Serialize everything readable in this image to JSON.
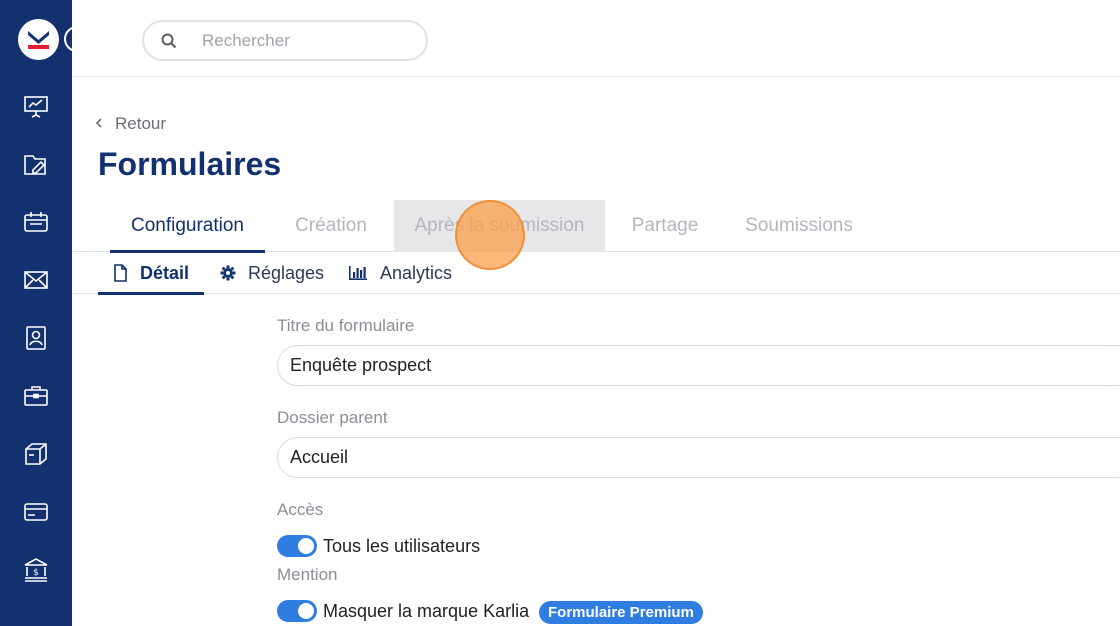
{
  "search": {
    "placeholder": "Rechercher"
  },
  "nav_icons": [
    "presentation-icon",
    "folder-edit-icon",
    "calendar-icon",
    "mail-icon",
    "contact-card-icon",
    "briefcase-icon",
    "box-icon",
    "credit-card-icon",
    "bank-icon"
  ],
  "back": {
    "label": "Retour"
  },
  "page": {
    "title": "Formulaires"
  },
  "tabs": [
    {
      "label": "Configuration",
      "state": "active"
    },
    {
      "label": "Création",
      "state": "inactive"
    },
    {
      "label": "Après la soumission",
      "state": "hover"
    },
    {
      "label": "Partage",
      "state": "inactive"
    },
    {
      "label": "Soumissions",
      "state": "inactive"
    }
  ],
  "subtabs": [
    {
      "label": "Détail",
      "icon": "document-icon",
      "state": "active"
    },
    {
      "label": "Réglages",
      "icon": "gear-icon",
      "state": "inactive"
    },
    {
      "label": "Analytics",
      "icon": "bar-chart-icon",
      "state": "inactive"
    }
  ],
  "form": {
    "title_label": "Titre du formulaire",
    "title_value": "Enquête prospect",
    "parent_label": "Dossier parent",
    "parent_value": "Accueil",
    "access_label": "Accès",
    "access_toggle": {
      "label": "Tous les utilisateurs",
      "on": true
    },
    "mention_label": "Mention",
    "mention_toggle": {
      "label": "Masquer la marque Karlia",
      "on": true
    },
    "premium_badge": "Formulaire Premium"
  },
  "colors": {
    "primary": "#12316e",
    "accent": "#2f7de1",
    "logo_red": "#e0202e"
  }
}
